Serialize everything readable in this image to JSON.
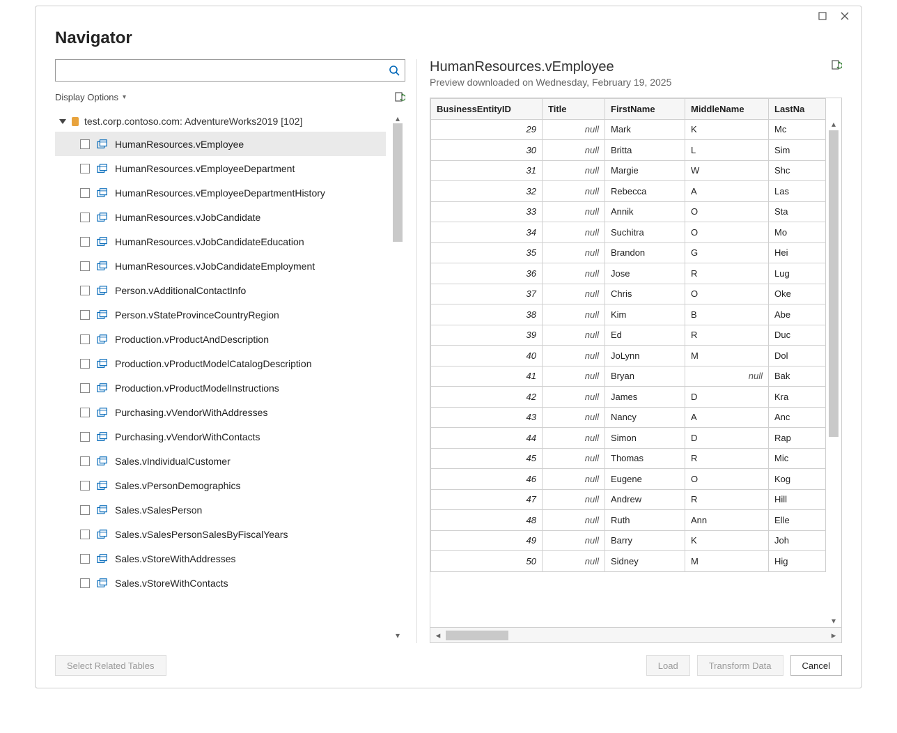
{
  "window": {
    "title": "Navigator",
    "search_placeholder": "",
    "display_options_label": "Display Options"
  },
  "database": {
    "label": "test.corp.contoso.com: AdventureWorks2019 [102]",
    "views": [
      {
        "name": "HumanResources.vEmployee",
        "selected": true
      },
      {
        "name": "HumanResources.vEmployeeDepartment",
        "selected": false
      },
      {
        "name": "HumanResources.vEmployeeDepartmentHistory",
        "selected": false
      },
      {
        "name": "HumanResources.vJobCandidate",
        "selected": false
      },
      {
        "name": "HumanResources.vJobCandidateEducation",
        "selected": false
      },
      {
        "name": "HumanResources.vJobCandidateEmployment",
        "selected": false
      },
      {
        "name": "Person.vAdditionalContactInfo",
        "selected": false
      },
      {
        "name": "Person.vStateProvinceCountryRegion",
        "selected": false
      },
      {
        "name": "Production.vProductAndDescription",
        "selected": false
      },
      {
        "name": "Production.vProductModelCatalogDescription",
        "selected": false
      },
      {
        "name": "Production.vProductModelInstructions",
        "selected": false
      },
      {
        "name": "Purchasing.vVendorWithAddresses",
        "selected": false
      },
      {
        "name": "Purchasing.vVendorWithContacts",
        "selected": false
      },
      {
        "name": "Sales.vIndividualCustomer",
        "selected": false
      },
      {
        "name": "Sales.vPersonDemographics",
        "selected": false
      },
      {
        "name": "Sales.vSalesPerson",
        "selected": false
      },
      {
        "name": "Sales.vSalesPersonSalesByFiscalYears",
        "selected": false
      },
      {
        "name": "Sales.vStoreWithAddresses",
        "selected": false
      },
      {
        "name": "Sales.vStoreWithContacts",
        "selected": false
      }
    ]
  },
  "preview": {
    "title": "HumanResources.vEmployee",
    "subtitle": "Preview downloaded on Wednesday, February 19, 2025",
    "columns": [
      "BusinessEntityID",
      "Title",
      "FirstName",
      "MiddleName",
      "LastNa"
    ],
    "rows": [
      {
        "id": 29,
        "title": "null",
        "first": "Mark",
        "middle": "K",
        "last": "Mc"
      },
      {
        "id": 30,
        "title": "null",
        "first": "Britta",
        "middle": "L",
        "last": "Sim"
      },
      {
        "id": 31,
        "title": "null",
        "first": "Margie",
        "middle": "W",
        "last": "Shc"
      },
      {
        "id": 32,
        "title": "null",
        "first": "Rebecca",
        "middle": "A",
        "last": "Las"
      },
      {
        "id": 33,
        "title": "null",
        "first": "Annik",
        "middle": "O",
        "last": "Sta"
      },
      {
        "id": 34,
        "title": "null",
        "first": "Suchitra",
        "middle": "O",
        "last": "Mo"
      },
      {
        "id": 35,
        "title": "null",
        "first": "Brandon",
        "middle": "G",
        "last": "Hei"
      },
      {
        "id": 36,
        "title": "null",
        "first": "Jose",
        "middle": "R",
        "last": "Lug"
      },
      {
        "id": 37,
        "title": "null",
        "first": "Chris",
        "middle": "O",
        "last": "Oke"
      },
      {
        "id": 38,
        "title": "null",
        "first": "Kim",
        "middle": "B",
        "last": "Abe"
      },
      {
        "id": 39,
        "title": "null",
        "first": "Ed",
        "middle": "R",
        "last": "Duc"
      },
      {
        "id": 40,
        "title": "null",
        "first": "JoLynn",
        "middle": "M",
        "last": "Dol"
      },
      {
        "id": 41,
        "title": "null",
        "first": "Bryan",
        "middle": "null",
        "last": "Bak"
      },
      {
        "id": 42,
        "title": "null",
        "first": "James",
        "middle": "D",
        "last": "Kra"
      },
      {
        "id": 43,
        "title": "null",
        "first": "Nancy",
        "middle": "A",
        "last": "Anc"
      },
      {
        "id": 44,
        "title": "null",
        "first": "Simon",
        "middle": "D",
        "last": "Rap"
      },
      {
        "id": 45,
        "title": "null",
        "first": "Thomas",
        "middle": "R",
        "last": "Mic"
      },
      {
        "id": 46,
        "title": "null",
        "first": "Eugene",
        "middle": "O",
        "last": "Kog"
      },
      {
        "id": 47,
        "title": "null",
        "first": "Andrew",
        "middle": "R",
        "last": "Hill"
      },
      {
        "id": 48,
        "title": "null",
        "first": "Ruth",
        "middle": "Ann",
        "last": "Elle"
      },
      {
        "id": 49,
        "title": "null",
        "first": "Barry",
        "middle": "K",
        "last": "Joh"
      },
      {
        "id": 50,
        "title": "null",
        "first": "Sidney",
        "middle": "M",
        "last": "Hig"
      }
    ]
  },
  "footer": {
    "select_related": "Select Related Tables",
    "load": "Load",
    "transform": "Transform Data",
    "cancel": "Cancel"
  }
}
